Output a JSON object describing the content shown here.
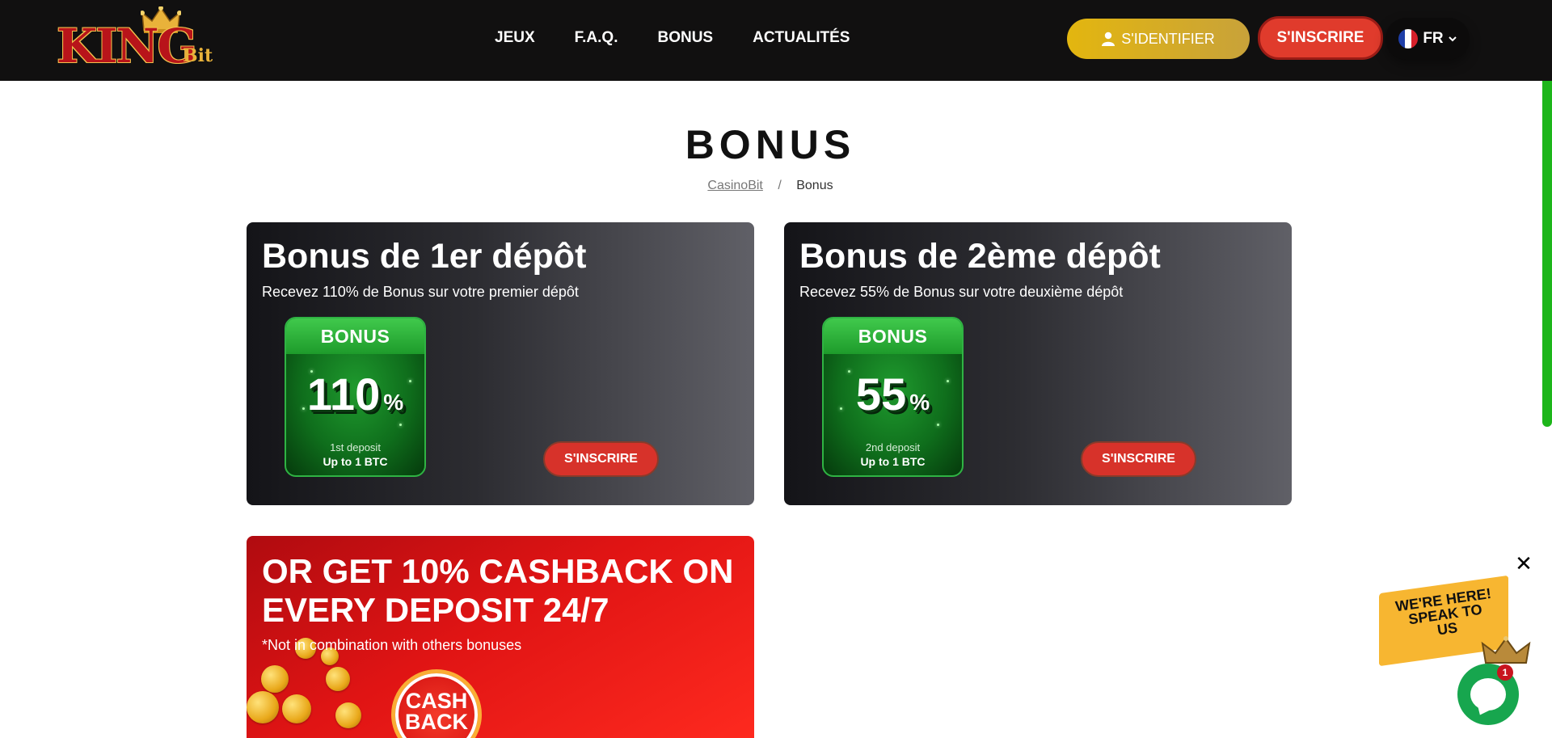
{
  "brand": {
    "logo_main": "KING",
    "logo_sub": "Bit"
  },
  "nav": {
    "items": [
      {
        "label": "JEUX"
      },
      {
        "label": "F.A.Q."
      },
      {
        "label": "BONUS"
      },
      {
        "label": "ACTUALITÉS"
      }
    ]
  },
  "header": {
    "login_label": "S'IDENTIFIER",
    "signup_label": "S'INSCRIRE",
    "language": "FR"
  },
  "page": {
    "title": "BONUS",
    "breadcrumb": {
      "home": "CasinoBit",
      "separator": "/",
      "current": "Bonus"
    }
  },
  "cards": [
    {
      "title": "Bonus de 1er dépôt",
      "subtitle": "Recevez 110% de Bonus sur votre premier dépôt",
      "badge_header": "BONUS",
      "badge_value": "110",
      "badge_percent": "%",
      "badge_deposit": "1st deposit",
      "badge_limit": "Up to 1 BTC",
      "cta_label": "S'INSCRIRE"
    },
    {
      "title": "Bonus de 2ème dépôt",
      "subtitle": "Recevez 55% de Bonus sur votre deuxième dépôt",
      "badge_header": "BONUS",
      "badge_value": "55",
      "badge_percent": "%",
      "badge_deposit": "2nd deposit",
      "badge_limit": "Up to 1 BTC",
      "cta_label": "S'INSCRIRE"
    }
  ],
  "cashback_card": {
    "title": "OR GET 10% CASHBACK ON EVERY DEPOSIT 24/7",
    "subtitle": "*Not in combination with others bonuses",
    "emblem_line1": "CASH",
    "emblem_line2": "BACK"
  },
  "chat": {
    "banner_text": "WE'RE HERE! SPEAK TO US",
    "close_symbol": "✕",
    "unread_count": "1"
  },
  "colors": {
    "header_bg": "#111010",
    "login_gold": "#e3b60f",
    "signup_red": "#e03b2c",
    "badge_green": "#1f9a2e",
    "cashback_red": "#e01414",
    "chat_green": "#17a64e",
    "scrollbar_green": "#1db61a"
  }
}
